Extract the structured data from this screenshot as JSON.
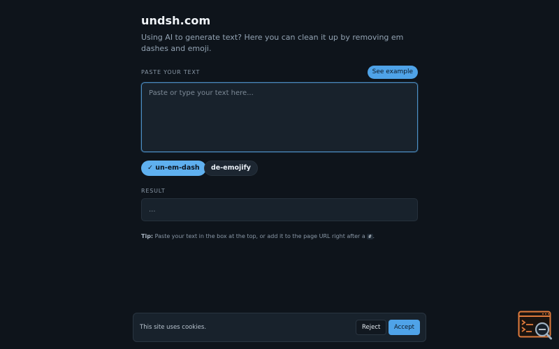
{
  "site": {
    "title": "undsh.com",
    "subtitle": "Using AI to generate text? Here you can clean it up by removing em dashes and emoji."
  },
  "input": {
    "label": "PASTE YOUR TEXT",
    "example_button": "See example",
    "placeholder": "Paste or type your text here..."
  },
  "options": [
    {
      "label": "✓ un-em-dash",
      "active": true
    },
    {
      "label": "de-emojify",
      "active": false
    }
  ],
  "result": {
    "label": "RESULT",
    "value": "..."
  },
  "tip": {
    "prefix": "Tip:",
    "text": " Paste your text in the box at the top, or add it to the page URL right after a ",
    "code": "#",
    "suffix": "."
  },
  "cookie": {
    "message": "This site uses cookies.",
    "reject": "Reject",
    "accept": "Accept"
  },
  "colors": {
    "background": "#0e141b",
    "accent": "#4fa3e8",
    "widget": "#e07b3c"
  },
  "icons": {
    "corner_widget": "terminal-search-icon"
  }
}
